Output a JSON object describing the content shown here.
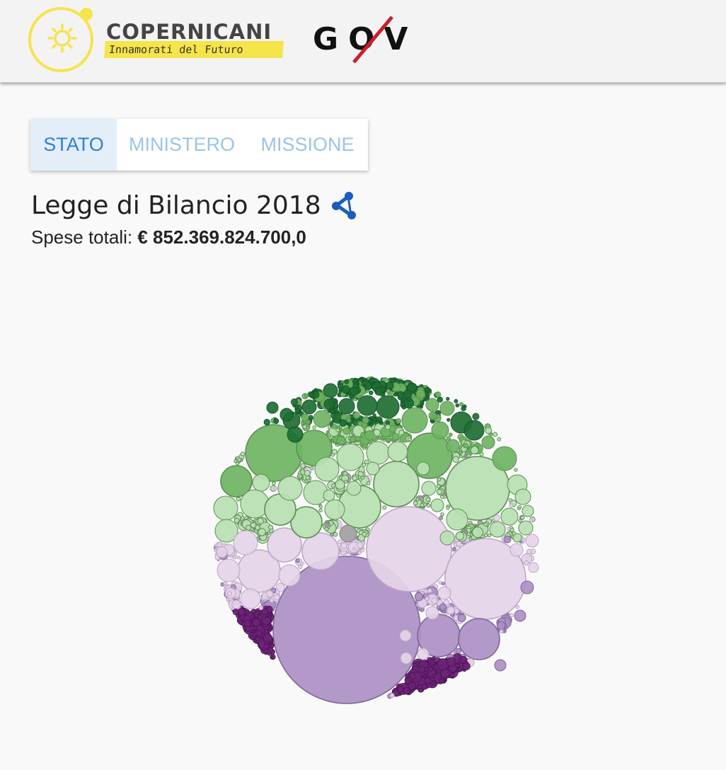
{
  "brand": {
    "name": "COPERNICANI",
    "tagline": "Innamorati del Futuro",
    "gov_logo_text": "GOV"
  },
  "tabs": [
    {
      "label": "STATO",
      "active": true
    },
    {
      "label": "MINISTERO",
      "active": false
    },
    {
      "label": "MISSIONE",
      "active": false
    }
  ],
  "page": {
    "title": "Legge di Bilancio 2018",
    "spending_label": "Spese totali:",
    "spending_value": "€ 852.369.824.700,0"
  },
  "icons": {
    "logo": "sun-logo-icon",
    "share": "share-icon"
  },
  "colors": {
    "dark_green": "#1e6e33",
    "mid_green": "#6fb463",
    "light_green": "#b9dfb2",
    "light_purple": "#e5d4e8",
    "mid_purple": "#ad8fc5",
    "dark_purple": "#6d2477",
    "gray": "#a0a0a0",
    "tab_active": "#2f7fd1",
    "tab_inactive": "#9cc3ea",
    "brand_yellow": "#f5e44a",
    "share_blue": "#1a5dbd"
  }
}
